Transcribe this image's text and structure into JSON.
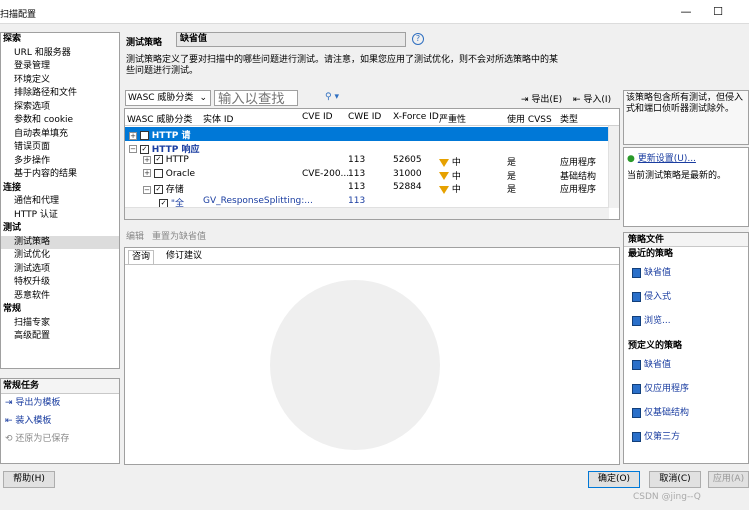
{
  "window": {
    "title": "扫描配置",
    "min": "—",
    "max": "☐"
  },
  "nav": {
    "items": [
      {
        "label": "探索",
        "type": "h"
      },
      {
        "label": "URL 和服务器",
        "type": "i"
      },
      {
        "label": "登录管理",
        "type": "i"
      },
      {
        "label": "环境定义",
        "type": "i"
      },
      {
        "label": "排除路径和文件",
        "type": "i"
      },
      {
        "label": "探索选项",
        "type": "i"
      },
      {
        "label": "参数和 cookie",
        "type": "i"
      },
      {
        "label": "自动表单填充",
        "type": "i"
      },
      {
        "label": "错误页面",
        "type": "i"
      },
      {
        "label": "多步操作",
        "type": "i"
      },
      {
        "label": "基于内容的结果",
        "type": "i"
      },
      {
        "label": "连接",
        "type": "h"
      },
      {
        "label": "通信和代理",
        "type": "i"
      },
      {
        "label": "HTTP 认证",
        "type": "i"
      },
      {
        "label": "测试",
        "type": "h"
      },
      {
        "label": "测试策略",
        "type": "i",
        "selected": true
      },
      {
        "label": "测试优化",
        "type": "i"
      },
      {
        "label": "测试选项",
        "type": "i"
      },
      {
        "label": "特权升级",
        "type": "i"
      },
      {
        "label": "恶意软件",
        "type": "i"
      },
      {
        "label": "常规",
        "type": "h"
      },
      {
        "label": "扫描专家",
        "type": "i"
      },
      {
        "label": "高级配置",
        "type": "i"
      }
    ]
  },
  "tasks": {
    "header": "常规任务",
    "export": "导出为模板",
    "load": "装入模板",
    "restore": "还原为已保存"
  },
  "help_button": "帮助(H)",
  "policy": {
    "label": "测试策略",
    "value": "缺省值",
    "description": "测试策略定义了要对扫描中的哪些问题进行测试。请注意，如果您应用了测试优化，则不会对所选策略中的某些问题进行测试。"
  },
  "toolbar": {
    "group_by": "WASC 威胁分类",
    "search_placeholder": "输入以查找",
    "export": "导出(E)",
    "import": "导入(I)"
  },
  "grid": {
    "columns": [
      "WASC 威胁分类",
      "实体 ID",
      "CVE ID",
      "CWE ID",
      "X-Force ID",
      "严重性",
      "使用 CVSS",
      "类型"
    ],
    "rows": [
      {
        "tree": "+",
        "check": "",
        "name": "HTTP 请",
        "entity": "",
        "cve": "",
        "cwe": "",
        "xforce": "",
        "severity": "",
        "cvss": "",
        "type": "",
        "selected": true
      },
      {
        "tree": "−",
        "check": "✓",
        "name": "HTTP 响应",
        "entity": "",
        "cve": "",
        "cwe": "",
        "xforce": "",
        "severity": "",
        "cvss": "",
        "type": ""
      },
      {
        "tree": "+",
        "check": "✓",
        "name": "HTTP",
        "entity": "",
        "cve": "",
        "cwe": "113",
        "xforce": "52605",
        "severity": "中",
        "cvss": "是",
        "type": "应用程序"
      },
      {
        "tree": "+",
        "check": "",
        "name": "Oracle",
        "entity": "",
        "cve": "CVE-200...",
        "cwe": "113",
        "xforce": "31000",
        "severity": "中",
        "cvss": "是",
        "type": "基础结构"
      },
      {
        "tree": "−",
        "check": "✓",
        "name": "存储",
        "entity": "",
        "cve": "",
        "cwe": "113",
        "xforce": "52884",
        "severity": "中",
        "cvss": "是",
        "type": "应用程序"
      },
      {
        "tree": "",
        "check": "✓",
        "name": "\"全",
        "entity": "GV_ResponseSplitting:...",
        "cve": "",
        "cwe": "113",
        "xforce": "",
        "severity": "",
        "cvss": "",
        "type": ""
      }
    ]
  },
  "detail": {
    "edit": "编辑",
    "reset": "重置为缺省值",
    "tab_advisory": "咨询",
    "tab_fix": "修订建议"
  },
  "right": {
    "desc": "该策略包含所有测试，但侵入式和端口侦听器测试除外。",
    "update_link": "更新设置(U)...",
    "update_status": "当前测试策略是最新的。",
    "files_header": "策略文件",
    "recent_header": "最近的策略",
    "recent": [
      "缺省值",
      "侵入式",
      "浏览..."
    ],
    "predef_header": "预定义的策略",
    "predef": [
      "缺省值",
      "仅应用程序",
      "仅基础结构",
      "仅第三方"
    ]
  },
  "footer": {
    "ok": "确定(O)",
    "cancel": "取消(C)",
    "apply": "应用(A)",
    "watermark": "CSDN @jing--Q"
  }
}
